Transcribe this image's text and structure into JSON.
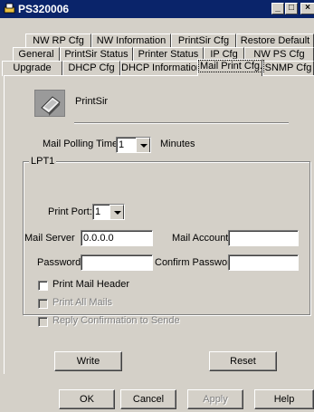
{
  "window": {
    "title": "PS320006",
    "minimize": "_",
    "maximize": "□",
    "close": "×"
  },
  "tabs_row1": [
    "NW RP Cfg",
    "NW Information",
    "PrintSir Cfg",
    "Restore Default"
  ],
  "tabs_row2": [
    "General",
    "PrintSir Status",
    "Printer Status",
    "IP Cfg",
    "NW PS Cfg"
  ],
  "tabs_row3": [
    "Upgrade",
    "DHCP Cfg",
    "DHCP Information",
    "Mail Print Cfg.",
    "SNMP Cfg"
  ],
  "selected_tab": "Mail Print Cfg.",
  "header": {
    "icon": "printer-icon",
    "label": "PrintSir"
  },
  "polling": {
    "label": "Mail Polling Time:",
    "value": "1",
    "unit": "Minutes"
  },
  "lpt_group": {
    "title": "LPT1",
    "print_port_label": "Print Port:",
    "print_port_value": "1",
    "mail_server_label": "Mail Server",
    "mail_server_value": "0.0.0.0",
    "mail_account_label": "Mail Account",
    "mail_account_value": "",
    "password_label": "Password",
    "password_value": "",
    "confirm_password_label": "Confirm Password",
    "confirm_password_value": "",
    "print_mail_header": "Print Mail Header",
    "print_all_mails": "Print All Mails",
    "reply_confirmation": "Reply Confirmation to Sende"
  },
  "actions": {
    "write": "Write",
    "reset": "Reset"
  },
  "footer": {
    "ok": "OK",
    "cancel": "Cancel",
    "apply": "Apply",
    "help": "Help"
  }
}
